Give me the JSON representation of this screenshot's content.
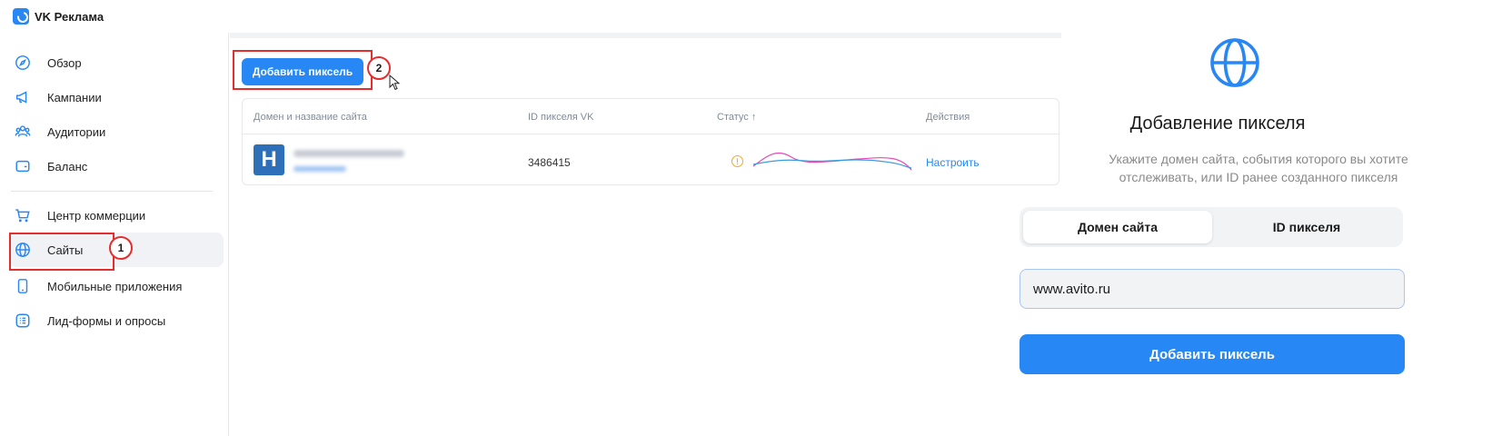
{
  "app": {
    "title": "VK Реклама"
  },
  "sidebar": {
    "items": [
      {
        "label": "Обзор",
        "icon": "compass-icon"
      },
      {
        "label": "Кампании",
        "icon": "megaphone-icon"
      },
      {
        "label": "Аудитории",
        "icon": "users-icon"
      },
      {
        "label": "Баланс",
        "icon": "wallet-icon"
      },
      {
        "label": "Центр коммерции",
        "icon": "cart-icon"
      },
      {
        "label": "Сайты",
        "icon": "globe-icon",
        "active": true
      },
      {
        "label": "Мобильные приложения",
        "icon": "phone-icon"
      },
      {
        "label": "Лид-формы и опросы",
        "icon": "form-icon"
      }
    ]
  },
  "main": {
    "add_button_label": "Добавить пиксель",
    "table": {
      "headers": [
        "Домен и название сайта",
        "ID пикселя VK",
        "Статус ↑",
        "Действия"
      ],
      "rows": [
        {
          "favicon_letter": "H",
          "pixel_id": "3486415",
          "action": "Настроить"
        }
      ]
    }
  },
  "annotations": {
    "step1": "1",
    "step2": "2"
  },
  "modal": {
    "title": "Добавление пикселя",
    "subtitle_line1": "Укажите домен сайта, события которого вы хотите",
    "subtitle_line2": "отслеживать, или ID ранее созданного пикселя",
    "tabs": [
      "Домен сайта",
      "ID пикселя"
    ],
    "domain_value": "www.avito.ru",
    "submit_label": "Добавить пиксель"
  },
  "colors": {
    "accent": "#2787f5",
    "highlight": "#e52d2d",
    "warning": "#f0a830"
  }
}
